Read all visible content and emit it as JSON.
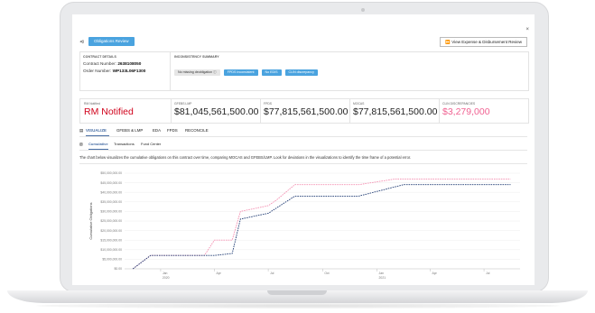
{
  "header": {
    "close_label": "×",
    "share_icon": "share-icon",
    "obligations_review_label": "Obligations Review",
    "expense_review_label": "View Expense & Disbursement Review",
    "expense_icon": "forward-icon"
  },
  "contract": {
    "section_label": "CONTRACT DETAILS",
    "contract_number_label": "Contract Number:",
    "contract_number": "2638108050",
    "order_number_label": "Order Number:",
    "order_number": "WP133L06F1300"
  },
  "inconsistency": {
    "section_label": "INCONSISTENCY SUMMARY",
    "chips": [
      {
        "label": "No missing deobligation",
        "style": "gray",
        "icon": "info-icon"
      },
      {
        "label": "FPDS Inconsistent",
        "style": "blue",
        "icon": ""
      },
      {
        "label": "No EDIS",
        "style": "blue",
        "icon": ""
      },
      {
        "label": "CLIN discrepancy",
        "style": "blue",
        "icon": ""
      }
    ]
  },
  "stats": [
    {
      "label": "RM Notified",
      "value": "RM Notified",
      "tone": "red"
    },
    {
      "label": "GFEBS LMP",
      "value": "$81,045,561,500.00",
      "tone": "default"
    },
    {
      "label": "FPDS",
      "value": "$77,815,561,500.00",
      "tone": "default"
    },
    {
      "label": "MOCAS",
      "value": "$77,815,561,500.00",
      "tone": "default"
    },
    {
      "label": "CLIN DISCREPANCIES",
      "value": "$3,279,000",
      "tone": "pink"
    }
  ],
  "tabs": {
    "icon": "chart-icon",
    "items": [
      "VISUALIZE",
      "GFEBS & LMP",
      "EDA",
      "FPDS",
      "RECONCILE"
    ],
    "active": "VISUALIZE"
  },
  "subtabs": {
    "icon": "bar-chart-icon",
    "items": [
      "Cumulative",
      "Transactions",
      "Fund Center"
    ],
    "active": "Cumulative"
  },
  "description": "The chart below visualizes the cumulative obligations on this contract over time, comparing MOCAS and GFEBS/LMP. Look for deviations in the visualizations to identify the time frame of a potential error.",
  "colors": {
    "accent": "#4aa3df",
    "tab_active": "#4a6fa5",
    "alert": "#d0021b",
    "pink": "#f06292",
    "navy": "#1f3b73"
  },
  "chart_data": {
    "type": "line",
    "ylabel": "Cumulative Obligations",
    "ylim": [
      0,
      50000000
    ],
    "yticks": [
      "$0.00",
      "$5,000,000.00",
      "$10,000,000.00",
      "$15,000,000.00",
      "$20,000,000.00",
      "$25,000,000.00",
      "$30,000,000.00",
      "$35,000,000.00",
      "$40,000,000.00",
      "$45,000,000.00",
      "$50,000,000.00"
    ],
    "ytick_values": [
      0,
      5000000,
      10000000,
      15000000,
      20000000,
      25000000,
      30000000,
      35000000,
      40000000,
      45000000,
      50000000
    ],
    "xlim": [
      "2019-11-01",
      "2021-08-31"
    ],
    "xticks": [
      {
        "date": "2020-01-01",
        "label": "Jan",
        "year": "2020"
      },
      {
        "date": "2020-04-01",
        "label": "Apr",
        "year": ""
      },
      {
        "date": "2020-07-01",
        "label": "Jul",
        "year": ""
      },
      {
        "date": "2020-10-01",
        "label": "Oct",
        "year": ""
      },
      {
        "date": "2021-01-01",
        "label": "Jan",
        "year": "2021"
      },
      {
        "date": "2021-04-01",
        "label": "Apr",
        "year": ""
      },
      {
        "date": "2021-07-01",
        "label": "Jul",
        "year": ""
      }
    ],
    "grid": true,
    "series": [
      {
        "color": "#f48fb1",
        "points": [
          [
            "2019-11-15",
            0
          ],
          [
            "2019-12-15",
            7000000
          ],
          [
            "2020-03-15",
            7000000
          ],
          [
            "2020-04-01",
            15000000
          ],
          [
            "2020-05-01",
            15000000
          ],
          [
            "2020-05-15",
            30000000
          ],
          [
            "2020-06-15",
            32000000
          ],
          [
            "2020-07-01",
            33000000
          ],
          [
            "2020-07-15",
            36000000
          ],
          [
            "2020-08-15",
            44000000
          ],
          [
            "2020-12-01",
            44000000
          ],
          [
            "2021-02-01",
            47000000
          ],
          [
            "2021-08-15",
            47000000
          ]
        ]
      },
      {
        "color": "#1f3b73",
        "points": [
          [
            "2019-11-15",
            0
          ],
          [
            "2019-12-15",
            7000000
          ],
          [
            "2020-04-01",
            7000000
          ],
          [
            "2020-05-01",
            8000000
          ],
          [
            "2020-05-15",
            26000000
          ],
          [
            "2020-06-15",
            28000000
          ],
          [
            "2020-07-01",
            29000000
          ],
          [
            "2020-08-15",
            38000000
          ],
          [
            "2020-12-01",
            38000000
          ],
          [
            "2021-02-15",
            44000000
          ],
          [
            "2021-08-15",
            44000000
          ]
        ]
      }
    ]
  }
}
